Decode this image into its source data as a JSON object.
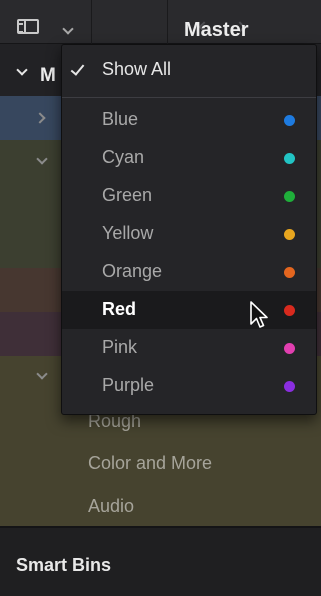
{
  "toolbar": {
    "title": "Master"
  },
  "sidebar": {
    "master_label": "M",
    "bins": [
      "Rough",
      "Color and More",
      "Audio"
    ],
    "smart_bins_label": "Smart Bins"
  },
  "menu": {
    "show_all_label": "Show All",
    "show_all_checked": true,
    "items": [
      {
        "label": "Blue",
        "color": "#1e7be0"
      },
      {
        "label": "Cyan",
        "color": "#22c4c4"
      },
      {
        "label": "Green",
        "color": "#1fae3a"
      },
      {
        "label": "Yellow",
        "color": "#e8a61f"
      },
      {
        "label": "Orange",
        "color": "#e4661f"
      },
      {
        "label": "Red",
        "color": "#d82a1e"
      },
      {
        "label": "Pink",
        "color": "#e23fb0"
      },
      {
        "label": "Purple",
        "color": "#8a2ee0"
      }
    ],
    "hovered_item": "Red"
  },
  "row_colors": {
    "blue": "#37475e",
    "green": "#3c3f30",
    "orange": "#473730",
    "pink": "#3f2f38",
    "yellow": "#46432f"
  },
  "icons": {
    "panel_toggle": "sidebar-panel-icon",
    "cursor": "mouse-pointer-icon"
  }
}
